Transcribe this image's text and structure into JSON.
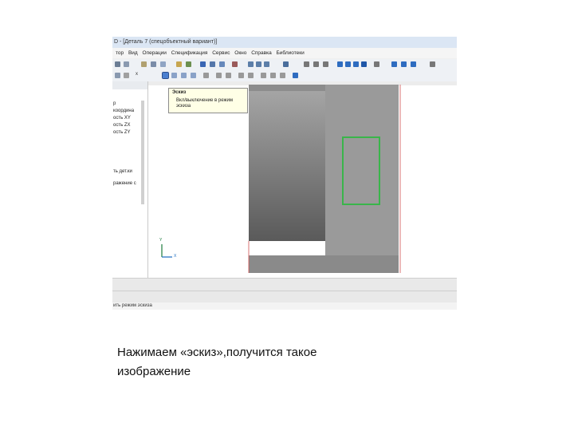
{
  "window": {
    "title": "D - [Деталь 7 (спецобъектный вариант)]"
  },
  "menu": [
    "тор",
    "Вид",
    "Операции",
    "Спецификация",
    "Сервис",
    "Окно",
    "Справка",
    "Библиотеки"
  ],
  "sidebar": {
    "close_label": "x",
    "items": [
      "р",
      "координа",
      "ость XY",
      "ость ZX",
      "ость ZY",
      "ть дет.ки",
      "ражение с"
    ]
  },
  "tooltip": {
    "title": "Эскиз",
    "text": "Вкл/выключение в режим эскиза"
  },
  "axes": {
    "y": "Y",
    "x": "X"
  },
  "status": {
    "text": "ить режим эскиза"
  },
  "caption": {
    "line1": "Нажимаем «эскиз»,получится такое",
    "line2": "изображение"
  },
  "colors": {
    "part": "#9a9a9a",
    "part_gradient_top": "#a8a8a8",
    "part_gradient_bottom": "#5a5a5a",
    "sketch_rect": "#39b54a",
    "axis": "#1c7a3c"
  }
}
